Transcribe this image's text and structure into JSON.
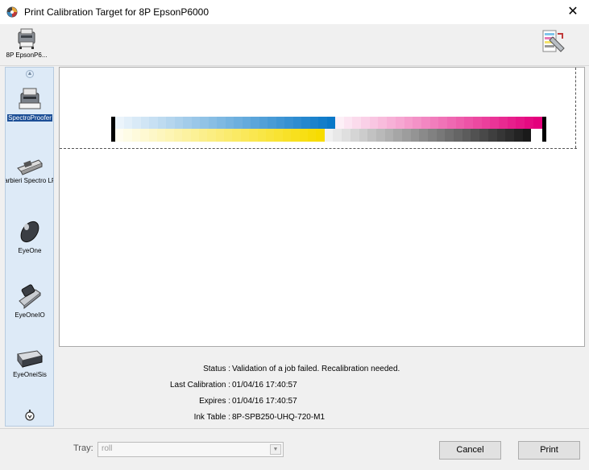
{
  "window": {
    "title": "Print Calibration Target for 8P EpsonP6000",
    "close_glyph": "✕"
  },
  "toolbar": {
    "printer_label": "8P EpsonP6..."
  },
  "sidebar": {
    "devices": [
      {
        "label": "SpectroProofer",
        "icon": "spectroproofer-icon",
        "selected": true
      },
      {
        "label": "Barbieri Spectro LFP",
        "icon": "barbieri-icon",
        "selected": false
      },
      {
        "label": "EyeOne",
        "icon": "eyeone-icon",
        "selected": false
      },
      {
        "label": "EyeOneIO",
        "icon": "eyeoneio-icon",
        "selected": false
      },
      {
        "label": "EyeOneiSis",
        "icon": "eyeoneisis-icon",
        "selected": false
      }
    ]
  },
  "status": {
    "status_label": "Status :",
    "status_value": "Validation of a job failed. Recalibration needed.",
    "last_cal_label": "Last Calibration :",
    "last_cal_value": "01/04/16 17:40:57",
    "expires_label": "Expires :",
    "expires_value": "01/04/16 17:40:57",
    "ink_table_label": "Ink Table :",
    "ink_table_value": "8P-SPB250-UHQ-720-M1"
  },
  "bottom": {
    "tray_label": "Tray:",
    "tray_value": "roll",
    "cancel_label": "Cancel",
    "print_label": "Print"
  },
  "colors": {
    "cyan": "#0a78c8",
    "magenta": "#e4007c",
    "yellow": "#f7dc00",
    "black": "#000000",
    "selection": "#1b4e96",
    "sidebar_bg": "#ddeaf7"
  }
}
